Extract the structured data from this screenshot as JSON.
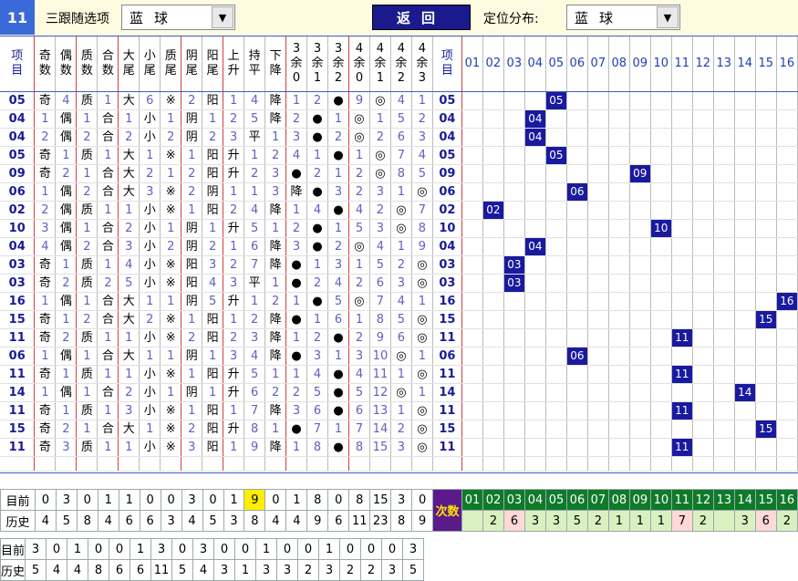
{
  "top": {
    "issue": "11",
    "label1": "三跟随选项",
    "sel1": "蓝球",
    "back": "返回",
    "label2": "定位分布:",
    "sel2": "蓝球"
  },
  "headers": [
    "项目",
    "奇数",
    "偶数",
    "质数",
    "合数",
    "大尾",
    "小尾",
    "质尾",
    "阴尾",
    "阳尾",
    "上升",
    "持平",
    "下降",
    "3余0",
    "3余1",
    "3余2",
    "4余0",
    "4余1",
    "4余2",
    "4余3",
    "项目"
  ],
  "dist_cols": [
    "01",
    "02",
    "03",
    "04",
    "05",
    "06",
    "07",
    "08",
    "09",
    "10",
    "11",
    "12",
    "13",
    "14",
    "15",
    "16"
  ],
  "rows": [
    {
      "n": "05",
      "c": [
        "奇",
        "4",
        "质",
        "1",
        "大",
        "6",
        "※",
        "2",
        "阳",
        "1",
        "4",
        "降",
        "1",
        "2",
        "●",
        "9",
        "◎",
        "4",
        "1"
      ],
      "v": 5
    },
    {
      "n": "04",
      "c": [
        "1",
        "偶",
        "1",
        "合",
        "1",
        "小",
        "1",
        "阴",
        "1",
        "2",
        "5",
        "降",
        "2",
        "●",
        "1",
        "◎",
        "1",
        "5",
        "2"
      ],
      "v": 4
    },
    {
      "n": "04",
      "c": [
        "2",
        "偶",
        "2",
        "合",
        "2",
        "小",
        "2",
        "阴",
        "2",
        "3",
        "平",
        "1",
        "3",
        "●",
        "2",
        "◎",
        "2",
        "6",
        "3"
      ],
      "v": 4
    },
    {
      "n": "05",
      "c": [
        "奇",
        "1",
        "质",
        "1",
        "大",
        "1",
        "※",
        "1",
        "阳",
        "升",
        "1",
        "2",
        "4",
        "1",
        "●",
        "1",
        "◎",
        "7",
        "4"
      ],
      "v": 5
    },
    {
      "n": "09",
      "c": [
        "奇",
        "2",
        "1",
        "合",
        "大",
        "2",
        "1",
        "2",
        "阳",
        "升",
        "2",
        "3",
        "●",
        "2",
        "1",
        "2",
        "◎",
        "8",
        "5"
      ],
      "v": 9
    },
    {
      "n": "06",
      "c": [
        "1",
        "偶",
        "2",
        "合",
        "大",
        "3",
        "※",
        "2",
        "阴",
        "1",
        "1",
        "3",
        "降",
        "●",
        "3",
        "2",
        "3",
        "1",
        "◎",
        "6"
      ],
      "v": 6
    },
    {
      "n": "02",
      "c": [
        "2",
        "偶",
        "质",
        "1",
        "1",
        "小",
        "※",
        "1",
        "阳",
        "2",
        "4",
        "降",
        "1",
        "4",
        "●",
        "4",
        "2",
        "◎",
        "7"
      ],
      "v": 2
    },
    {
      "n": "10",
      "c": [
        "3",
        "偶",
        "1",
        "合",
        "2",
        "小",
        "1",
        "阴",
        "1",
        "升",
        "5",
        "1",
        "2",
        "●",
        "1",
        "5",
        "3",
        "◎",
        "8"
      ],
      "v": 10
    },
    {
      "n": "04",
      "c": [
        "4",
        "偶",
        "2",
        "合",
        "3",
        "小",
        "2",
        "阴",
        "2",
        "1",
        "6",
        "降",
        "3",
        "●",
        "2",
        "◎",
        "4",
        "1",
        "9"
      ],
      "v": 4
    },
    {
      "n": "03",
      "c": [
        "奇",
        "1",
        "质",
        "1",
        "4",
        "小",
        "※",
        "阳",
        "3",
        "2",
        "7",
        "降",
        "●",
        "1",
        "3",
        "1",
        "5",
        "2",
        "◎"
      ],
      "v": 3
    },
    {
      "n": "03",
      "c": [
        "奇",
        "2",
        "质",
        "2",
        "5",
        "小",
        "※",
        "阳",
        "4",
        "3",
        "平",
        "1",
        "●",
        "2",
        "4",
        "2",
        "6",
        "3",
        "◎"
      ],
      "v": 3
    },
    {
      "n": "16",
      "c": [
        "1",
        "偶",
        "1",
        "合",
        "大",
        "1",
        "1",
        "阴",
        "5",
        "升",
        "1",
        "2",
        "1",
        "●",
        "5",
        "◎",
        "7",
        "4",
        "1"
      ],
      "v": 16
    },
    {
      "n": "15",
      "c": [
        "奇",
        "1",
        "2",
        "合",
        "大",
        "2",
        "※",
        "1",
        "阳",
        "1",
        "2",
        "降",
        "●",
        "1",
        "6",
        "1",
        "8",
        "5",
        "◎"
      ],
      "v": 15
    },
    {
      "n": "11",
      "c": [
        "奇",
        "2",
        "质",
        "1",
        "1",
        "小",
        "※",
        "2",
        "阳",
        "2",
        "3",
        "降",
        "1",
        "2",
        "●",
        "2",
        "9",
        "6",
        "◎"
      ],
      "v": 11
    },
    {
      "n": "06",
      "c": [
        "1",
        "偶",
        "1",
        "合",
        "大",
        "1",
        "1",
        "阴",
        "1",
        "3",
        "4",
        "降",
        "●",
        "3",
        "1",
        "3",
        "10",
        "◎",
        "1"
      ],
      "v": 6
    },
    {
      "n": "11",
      "c": [
        "奇",
        "1",
        "质",
        "1",
        "1",
        "小",
        "※",
        "1",
        "阳",
        "升",
        "5",
        "1",
        "1",
        "4",
        "●",
        "4",
        "11",
        "1",
        "◎"
      ],
      "v": 11
    },
    {
      "n": "14",
      "c": [
        "1",
        "偶",
        "1",
        "合",
        "2",
        "小",
        "1",
        "阴",
        "1",
        "升",
        "6",
        "2",
        "2",
        "5",
        "●",
        "5",
        "12",
        "◎",
        "1"
      ],
      "v": 14
    },
    {
      "n": "11",
      "c": [
        "奇",
        "1",
        "质",
        "1",
        "3",
        "小",
        "※",
        "1",
        "阳",
        "1",
        "7",
        "降",
        "3",
        "6",
        "●",
        "6",
        "13",
        "1",
        "◎"
      ],
      "v": 11
    },
    {
      "n": "15",
      "c": [
        "奇",
        "2",
        "1",
        "合",
        "大",
        "1",
        "※",
        "2",
        "阳",
        "升",
        "8",
        "1",
        "●",
        "7",
        "1",
        "7",
        "14",
        "2",
        "◎"
      ],
      "v": 15
    },
    {
      "n": "11",
      "c": [
        "奇",
        "3",
        "质",
        "1",
        "1",
        "小",
        "※",
        "3",
        "阳",
        "1",
        "9",
        "降",
        "1",
        "8",
        "●",
        "8",
        "15",
        "3",
        "◎"
      ],
      "v": 11
    }
  ],
  "sum": {
    "label_cur": "目前",
    "label_hist": "历史",
    "cishu": "次数",
    "cur": [
      "0",
      "3",
      "0",
      "1",
      "1",
      "0",
      "0",
      "3",
      "0",
      "1",
      "9",
      "0",
      "1",
      "8",
      "0",
      "8",
      "15",
      "3",
      "0"
    ],
    "hist": [
      "4",
      "5",
      "8",
      "4",
      "6",
      "6",
      "3",
      "4",
      "5",
      "3",
      "8",
      "4",
      "4",
      "9",
      "6",
      "11",
      "23",
      "8",
      "9"
    ],
    "dist_hist": [
      "",
      "2",
      "6",
      "3",
      "3",
      "5",
      "2",
      "1",
      "1",
      "1",
      "7",
      "2",
      "",
      "3",
      "6",
      "2"
    ]
  },
  "sum2": {
    "label_cur": "目前",
    "label_hist": "历史",
    "cur": [
      "3",
      "0",
      "1",
      "0",
      "0",
      "1",
      "3",
      "0",
      "3",
      "0",
      "0",
      "1",
      "0",
      "0",
      "1",
      "0",
      "0",
      "0",
      "3"
    ],
    "hist": [
      "5",
      "4",
      "4",
      "8",
      "6",
      "6",
      "11",
      "5",
      "4",
      "3",
      "1",
      "3",
      "3",
      "2",
      "3",
      "2",
      "2",
      "3",
      "5"
    ]
  }
}
